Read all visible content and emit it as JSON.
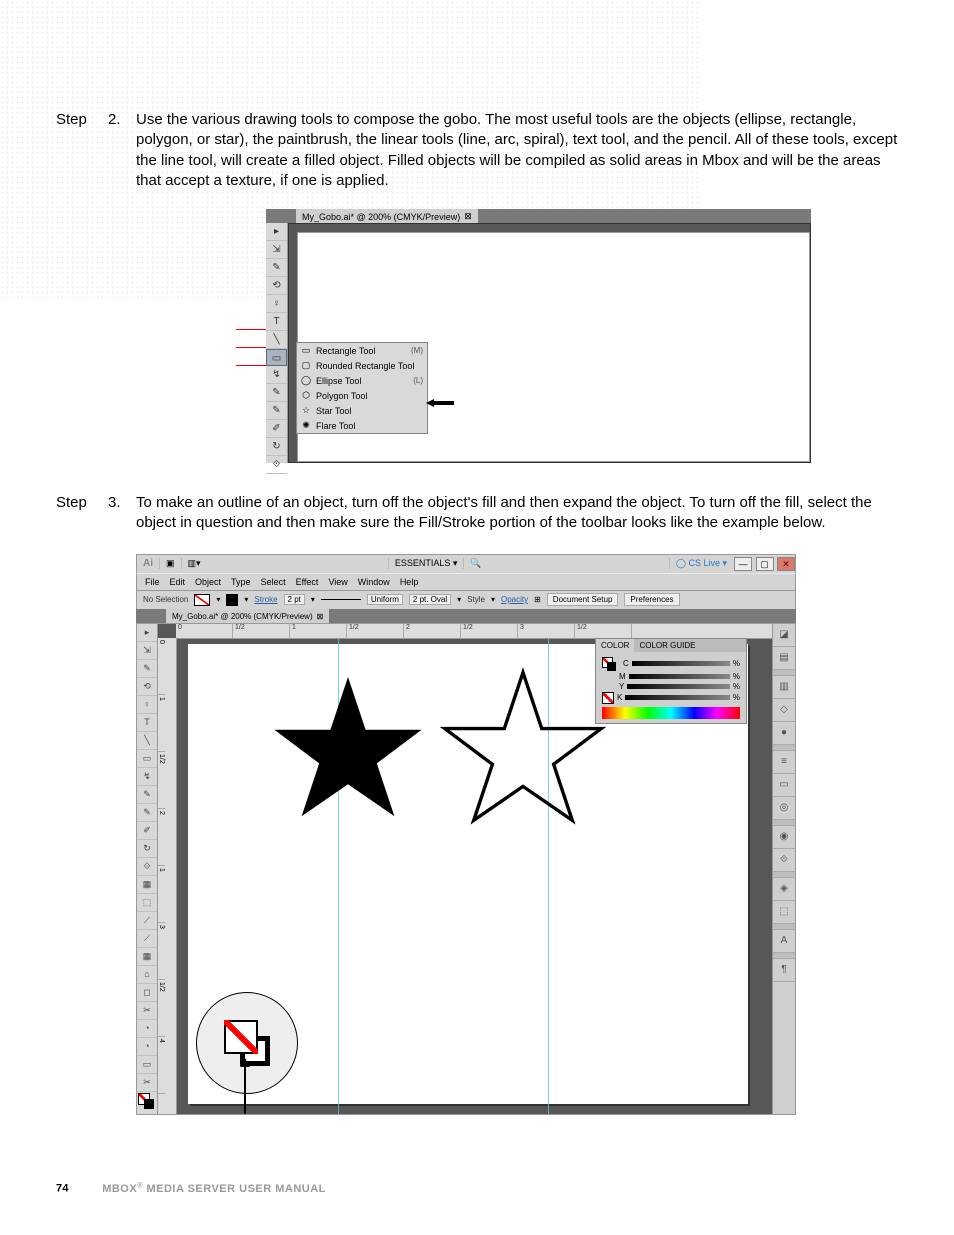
{
  "step2": {
    "label": "Step",
    "num": "2.",
    "text": "Use the various drawing tools to compose the gobo. The most useful tools are the objects (ellipse, rectangle, polygon, or star), the paintbrush, the linear tools (line, arc, spiral), text tool, and the pencil. All of these tools, except the line tool, will create a filled object. Filled objects will be compiled as solid areas in Mbox and will be the areas that accept a texture, if one is applied."
  },
  "step3": {
    "label": "Step",
    "num": "3.",
    "text": "To make an outline of an object, turn off the object's fill and then expand the object. To turn off the fill, select the object in question and then make sure the Fill/Stroke portion of the toolbar looks like the example below."
  },
  "fig1": {
    "tab_title": "My_Gobo.ai* @ 200% (CMYK/Preview)",
    "flyout": {
      "items": [
        {
          "icon": "▭",
          "label": "Rectangle Tool",
          "shortcut": "(M)"
        },
        {
          "icon": "▢",
          "label": "Rounded Rectangle Tool",
          "shortcut": ""
        },
        {
          "icon": "◯",
          "label": "Ellipse Tool",
          "shortcut": "(L)"
        },
        {
          "icon": "⬡",
          "label": "Polygon Tool",
          "shortcut": ""
        },
        {
          "icon": "☆",
          "label": "Star Tool",
          "shortcut": ""
        },
        {
          "icon": "✺",
          "label": "Flare Tool",
          "shortcut": ""
        }
      ]
    },
    "tools": [
      "▸",
      "⇲",
      "✎",
      "⟲",
      "♀",
      "T",
      "╲",
      "▭",
      "↯",
      "↯",
      "✎",
      "✐",
      "↻",
      "⟐"
    ]
  },
  "fig2": {
    "topbar": {
      "ai": "Ai",
      "essentials": "ESSENTIALS ▾",
      "cslive": "CS Live ▾",
      "min": "—",
      "max": "▢",
      "close": "✕"
    },
    "menubar": [
      "File",
      "Edit",
      "Object",
      "Type",
      "Select",
      "Effect",
      "View",
      "Window",
      "Help"
    ],
    "ctlbar": {
      "nosel": "No Selection",
      "stroke_lbl": "Stroke",
      "stroke_pt": "2 pt",
      "uniform": "Uniform",
      "oval": "2 pt. Oval",
      "style": "Style",
      "opacity": "Opacity",
      "docsetup": "Document Setup",
      "prefs": "Preferences"
    },
    "tab_title": "My_Gobo.ai* @ 200% (CMYK/Preview)",
    "ruler_h": [
      "0",
      "1/2",
      "1",
      "1/2",
      "2",
      "1/2",
      "3",
      "1/2"
    ],
    "ruler_v": [
      "0",
      "1",
      "1/2",
      "2",
      "1",
      "3",
      "1/2",
      "4",
      "1"
    ],
    "tools": [
      "▸",
      "⇲",
      "✎",
      "⟲",
      "♀",
      "T",
      "╲",
      "▭",
      "↯",
      "↯",
      "✎",
      "✐",
      "↻",
      "⟐",
      "▦",
      "⬚",
      "⟋",
      "⟋",
      "▦",
      "⌂",
      "◻",
      "✂",
      "◔",
      "◔"
    ],
    "colorpanel": {
      "tab1": "COLOR",
      "tab2": "COLOR GUIDE",
      "channels": [
        "C",
        "M",
        "Y",
        "K"
      ],
      "pct": "%"
    },
    "dock": [
      "⬚",
      "▤",
      "",
      "⬚",
      "◇",
      "●",
      "",
      "≡",
      "▭",
      "◎",
      "",
      "◉",
      "⟐",
      "",
      "◈",
      "⬚",
      "",
      "A",
      "",
      "¶"
    ]
  },
  "footer": {
    "page": "74",
    "title": "MBOX",
    "reg": "®",
    "rest": "MEDIA SERVER USER MANUAL"
  }
}
